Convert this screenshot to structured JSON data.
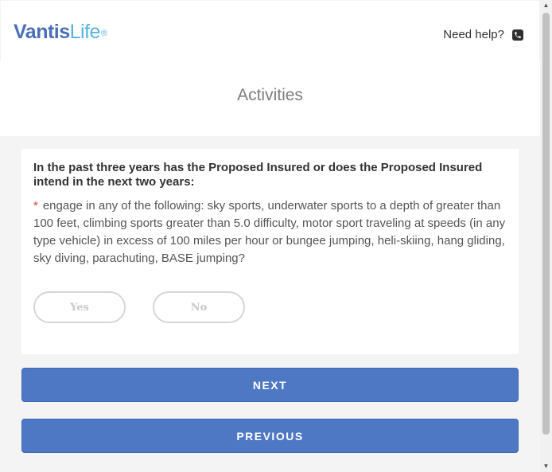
{
  "brand": {
    "name_part1": "Vantis",
    "name_part2": "Life",
    "registered": "®",
    "primary_color": "#4a6fb9",
    "secondary_color": "#55b3e2"
  },
  "header": {
    "help_label": "Need help?",
    "help_icon": "phone-icon"
  },
  "page": {
    "title": "Activities"
  },
  "question": {
    "text": "In the past three years has the Proposed Insured or does the Proposed Insured intend in the next two years:",
    "required_marker": "*",
    "detail": "engage in any of the following: sky sports, underwater sports to a depth of greater than 100 feet, climbing sports greater than 5.0 difficulty, motor sport traveling at speeds (in any type vehicle) in excess of 100 miles per hour or bungee jumping, heli-skiing, hang gliding, sky diving, parachuting, BASE jumping?",
    "options": {
      "yes": "Yes",
      "no": "No"
    }
  },
  "buttons": {
    "next": "NEXT",
    "previous": "PREVIOUS",
    "color": "#4e77c4"
  },
  "scrollbar": {
    "up_arrow": "▲",
    "down_arrow": "▼"
  }
}
